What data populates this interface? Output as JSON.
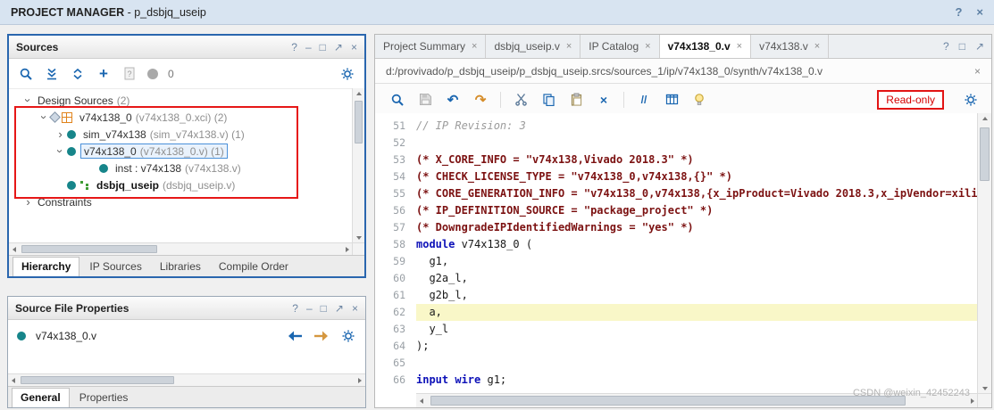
{
  "window": {
    "title": "PROJECT MANAGER",
    "subtitle": "- p_dsbjq_useip",
    "icons": [
      {
        "name": "help",
        "glyph": "?"
      },
      {
        "name": "close",
        "glyph": "×"
      }
    ]
  },
  "panel_header_icons": [
    {
      "name": "help",
      "glyph": "?"
    },
    {
      "name": "minimize",
      "glyph": "–"
    },
    {
      "name": "maximize",
      "glyph": "□"
    },
    {
      "name": "float",
      "glyph": "↗"
    },
    {
      "name": "close",
      "glyph": "×"
    }
  ],
  "icons": {
    "chevron": "›",
    "plus": "+",
    "undo": "↶",
    "redo": "↷",
    "delete": "×",
    "close": "×"
  },
  "sources": {
    "title": "Sources",
    "toolbar": {
      "badge": "0"
    },
    "tree": [
      {
        "ind": 0,
        "exp": "down",
        "icon": "none",
        "label": "Design Sources",
        "suffix": "(2)"
      },
      {
        "ind": 1,
        "exp": "down",
        "icon": "ip",
        "label": "v74x138_0",
        "suffix": "(v74x138_0.xci) (2)"
      },
      {
        "ind": 2,
        "exp": "right",
        "icon": "module",
        "label": "sim_v74x138",
        "suffix": "(sim_v74x138.v) (1)"
      },
      {
        "ind": 2,
        "exp": "down",
        "icon": "module",
        "label": "v74x138_0",
        "suffix": "(v74x138_0.v) (1)",
        "selected": true
      },
      {
        "ind": 4,
        "exp": "none",
        "icon": "module",
        "label": "inst : v74x138",
        "suffix": "(v74x138.v)"
      },
      {
        "ind": 2,
        "exp": "none",
        "icon": "module-tree",
        "label": "dsbjq_useip",
        "suffix": "(dsbjq_useip.v)",
        "bold": true
      },
      {
        "ind": 0,
        "exp": "right",
        "icon": "none",
        "label": "Constraints",
        "suffix": ""
      }
    ],
    "tabs": [
      {
        "label": "Hierarchy",
        "active": true
      },
      {
        "label": "IP Sources"
      },
      {
        "label": "Libraries"
      },
      {
        "label": "Compile Order"
      }
    ]
  },
  "properties": {
    "title": "Source File Properties",
    "file_name": "v74x138_0.v",
    "tabs": [
      {
        "label": "General",
        "active": true
      },
      {
        "label": "Properties"
      }
    ]
  },
  "editor": {
    "tabs": [
      {
        "label": "Project Summary"
      },
      {
        "label": "dsbjq_useip.v"
      },
      {
        "label": "IP Catalog"
      },
      {
        "label": "v74x138_0.v",
        "active": true
      },
      {
        "label": "v74x138.v"
      }
    ],
    "corner_icons": [
      {
        "name": "help",
        "glyph": "?"
      },
      {
        "name": "maximize",
        "glyph": "□"
      },
      {
        "name": "float",
        "glyph": "↗"
      }
    ],
    "path": "d:/provivado/p_dsbjq_useip/p_dsbjq_useip.srcs/sources_1/ip/v74x138_0/synth/v74x138_0.v",
    "readonly": "Read-only",
    "comment_tool": "//",
    "lines": [
      {
        "n": 51,
        "segs": [
          {
            "t": "// IP Revision: 3",
            "c": "comment"
          }
        ]
      },
      {
        "n": 52,
        "segs": []
      },
      {
        "n": 53,
        "segs": [
          {
            "t": "(* X_CORE_INFO = \"v74x138,Vivado 2018.3\" *)",
            "c": "attr"
          }
        ]
      },
      {
        "n": 54,
        "segs": [
          {
            "t": "(* CHECK_LICENSE_TYPE = \"v74x138_0,v74x138,{}\" *)",
            "c": "attr"
          }
        ]
      },
      {
        "n": 55,
        "segs": [
          {
            "t": "(* CORE_GENERATION_INFO = \"v74x138_0,v74x138,{x_ipProduct=Vivado 2018.3,x_ipVendor=xilinx.co",
            "c": "attr"
          }
        ]
      },
      {
        "n": 56,
        "segs": [
          {
            "t": "(* IP_DEFINITION_SOURCE = \"package_project\" *)",
            "c": "attr"
          }
        ]
      },
      {
        "n": 57,
        "segs": [
          {
            "t": "(* DowngradeIPIdentifiedWarnings = \"yes\" *)",
            "c": "attr"
          }
        ]
      },
      {
        "n": 58,
        "segs": [
          {
            "t": "module",
            "c": "kw"
          },
          {
            "t": " v74x138_0 (",
            "c": "plain"
          }
        ]
      },
      {
        "n": 59,
        "segs": [
          {
            "t": "  g1,",
            "c": "plain"
          }
        ]
      },
      {
        "n": 60,
        "segs": [
          {
            "t": "  g2a_l,",
            "c": "plain"
          }
        ]
      },
      {
        "n": 61,
        "segs": [
          {
            "t": "  g2b_l,",
            "c": "plain"
          }
        ]
      },
      {
        "n": 62,
        "segs": [
          {
            "t": "  a,",
            "c": "plain"
          }
        ],
        "hl": true
      },
      {
        "n": 63,
        "segs": [
          {
            "t": "  y_l",
            "c": "plain"
          }
        ]
      },
      {
        "n": 64,
        "segs": [
          {
            "t": ");",
            "c": "plain"
          }
        ]
      },
      {
        "n": 65,
        "segs": []
      },
      {
        "n": 66,
        "segs": [
          {
            "t": "input wire",
            "c": "kw"
          },
          {
            "t": " g1;",
            "c": "plain"
          }
        ]
      }
    ]
  },
  "watermark": "CSDN @weixin_42452243",
  "colors": {
    "accent_blue": "#1a66b0",
    "annotation_red": "#e61717",
    "keyword_blue": "#0d11b8",
    "attribute_red": "#7c1212",
    "comment_gray": "#9c9c9c",
    "icon_teal": "#16858a",
    "selection_blue": "#4a90d9",
    "highlight_yellow": "#f9f7c8",
    "titlebar_bg": "#d8e4f1"
  }
}
